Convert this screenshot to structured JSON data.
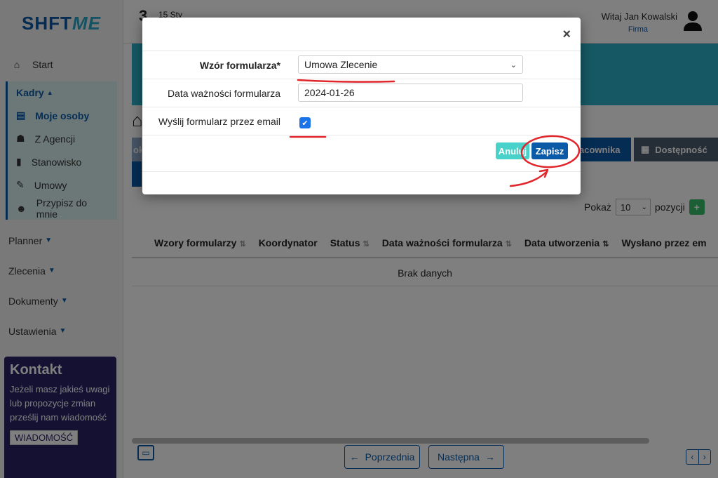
{
  "brand": {
    "logo_a": "SHFT",
    "logo_b": "ME"
  },
  "topbar": {
    "date_big": "3",
    "date_small": "15 Sty",
    "greeting": "Witaj Jan Kowalski",
    "company": "Firma"
  },
  "sidebar": {
    "start": "Start",
    "kadry": "Kadry",
    "kadry_items": [
      {
        "label": "Moje osoby",
        "icon": "id-card-icon"
      },
      {
        "label": "Z Agencji",
        "icon": "user-plus-icon"
      },
      {
        "label": "Stanowisko",
        "icon": "book-icon"
      },
      {
        "label": "Umowy",
        "icon": "file-edit-icon"
      },
      {
        "label": "Przypisz do mnie",
        "icon": "users-icon"
      }
    ],
    "sections": [
      "Planner",
      "Zlecenia",
      "Dokumenty",
      "Ustawienia"
    ]
  },
  "contact": {
    "title": "Kontakt",
    "text": "Jeżeli masz jakieś uwagi lub propozycje zmian prześlij nam wiadomość",
    "button": "WIADOMOŚĆ"
  },
  "tabs": {
    "pracownika": "acownika",
    "dostepnosc": "Dostępność",
    "ok": "ok"
  },
  "table": {
    "show_label": "Pokaż",
    "show_value": "10",
    "show_suffix": "pozycji",
    "columns": [
      "Wzory formularzy",
      "Koordynator",
      "Status",
      "Data ważności formularza",
      "Data utworzenia",
      "Wysłano przez em"
    ],
    "empty": "Brak danych"
  },
  "pager": {
    "prev": "Poprzednia",
    "next": "Następna"
  },
  "modal": {
    "close": "×",
    "fields": {
      "template_label": "Wzór formularza*",
      "template_value": "Umowa Zlecenie",
      "expiry_label": "Data ważności formularza",
      "expiry_value": "2024-01-26",
      "email_label": "Wyślij formularz przez email",
      "email_checked": true
    },
    "cancel": "Anuluj",
    "save": "Zapisz"
  },
  "colors": {
    "brand_blue": "#0b5aa8",
    "annotation_red": "#e0262b",
    "teal": "#2cb3c8"
  }
}
